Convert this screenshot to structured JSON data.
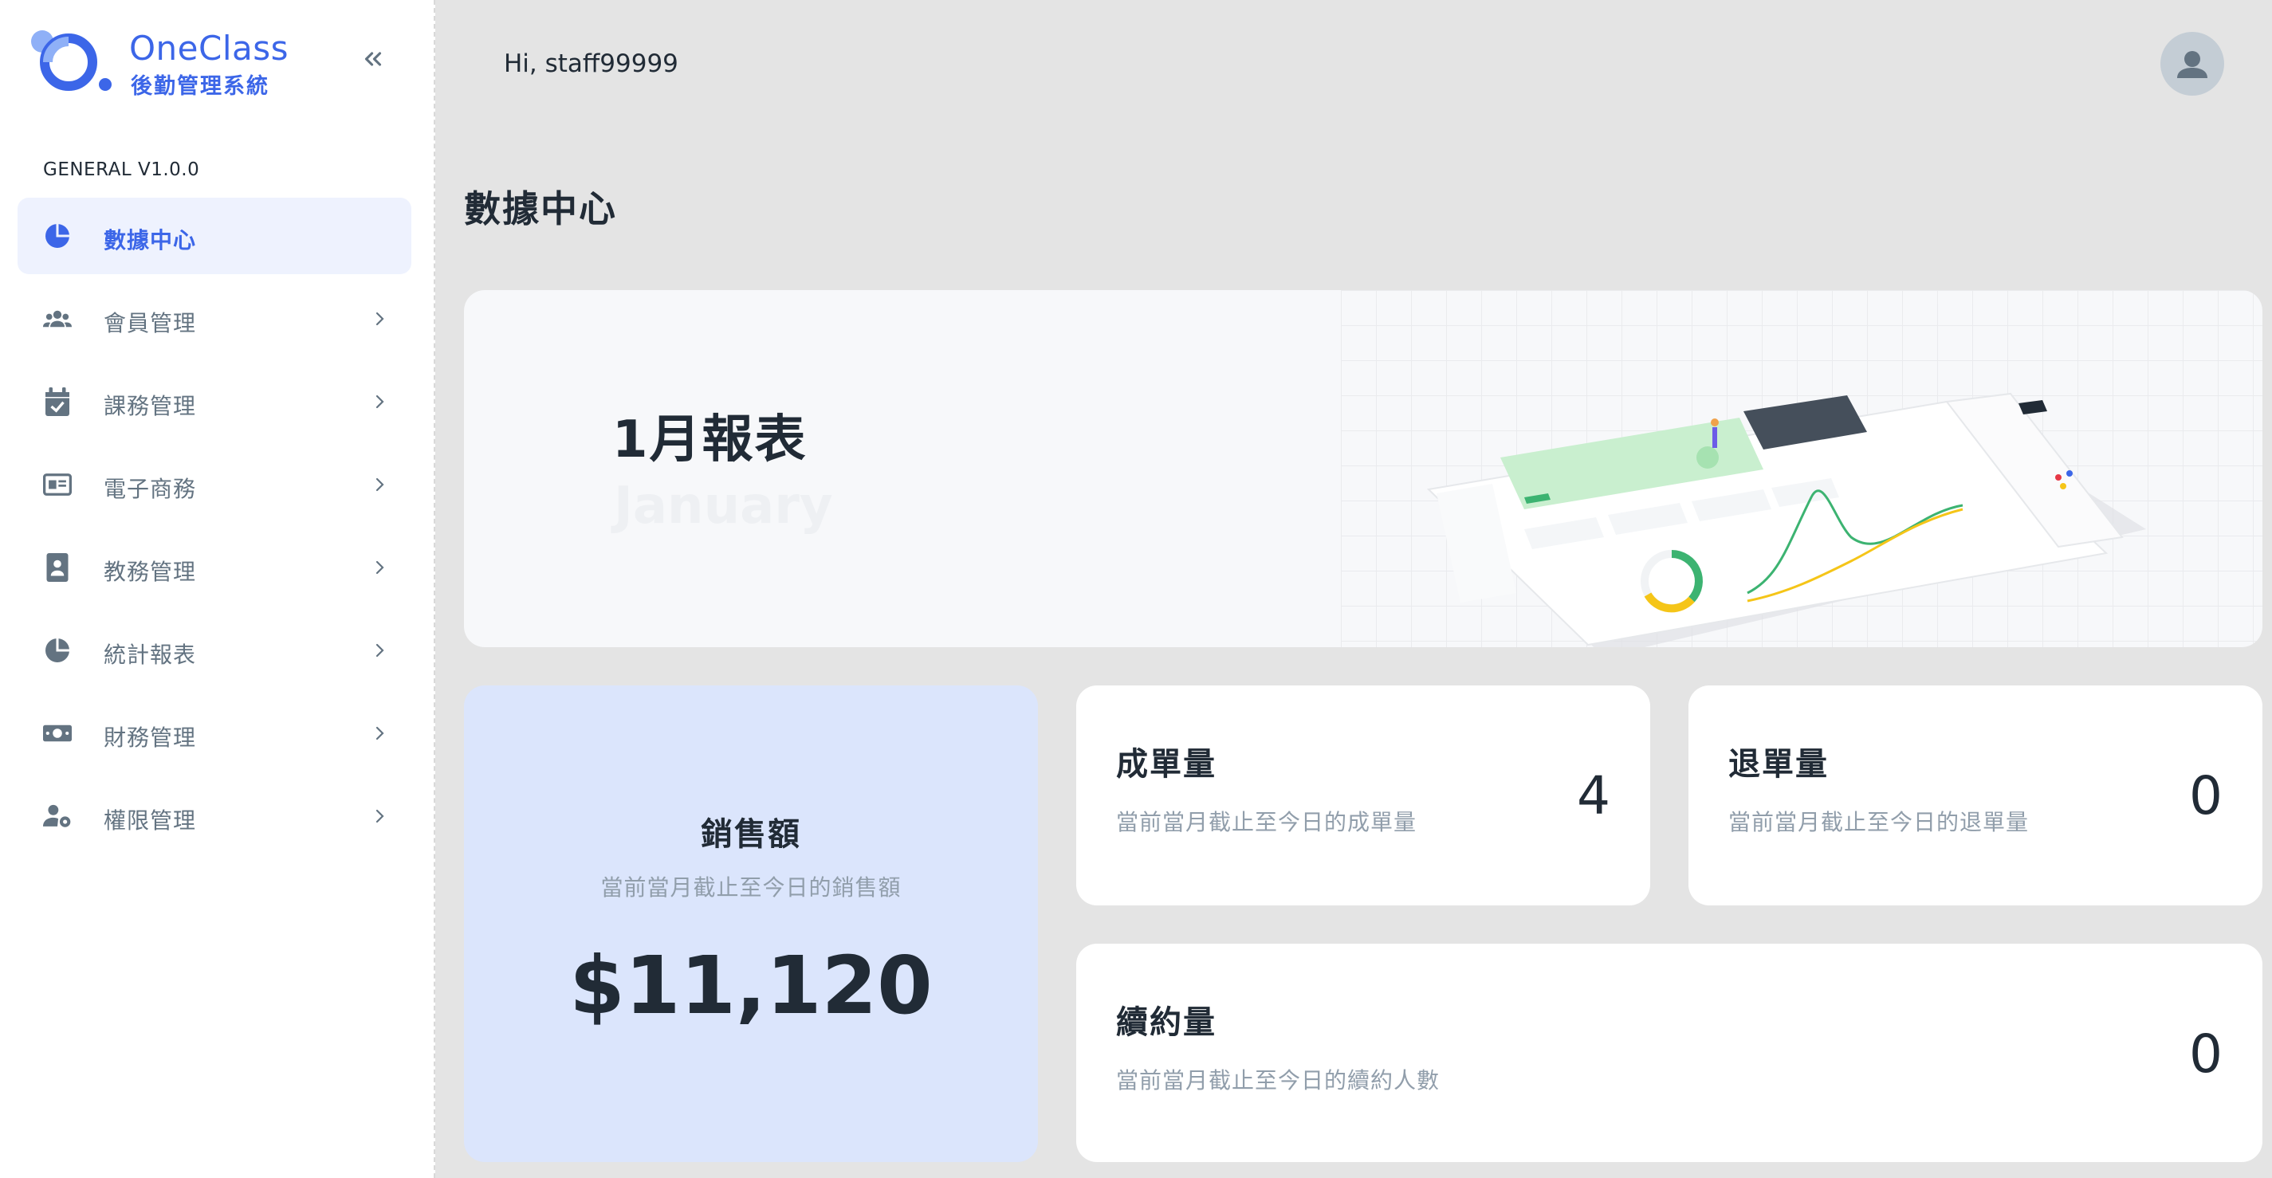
{
  "brand": {
    "name": "OneClass",
    "subtitle": "後勤管理系統",
    "color": "#3c66e8"
  },
  "sidebar": {
    "section_label": "GENERAL V1.0.0",
    "items": [
      {
        "label": "數據中心",
        "icon": "pie-chart-icon",
        "active": true
      },
      {
        "label": "會員管理",
        "icon": "users-icon",
        "active": false
      },
      {
        "label": "課務管理",
        "icon": "calendar-check-icon",
        "active": false
      },
      {
        "label": "電子商務",
        "icon": "id-card-icon",
        "active": false
      },
      {
        "label": "教務管理",
        "icon": "badge-icon",
        "active": false
      },
      {
        "label": "統計報表",
        "icon": "pie-chart-icon",
        "active": false
      },
      {
        "label": "財務管理",
        "icon": "money-icon",
        "active": false
      },
      {
        "label": "權限管理",
        "icon": "user-gear-icon",
        "active": false
      }
    ]
  },
  "header": {
    "greeting": "Hi, staff99999"
  },
  "page": {
    "title": "數據中心"
  },
  "banner": {
    "title": "1月報表",
    "subtitle": "January"
  },
  "stats": {
    "sales": {
      "title": "銷售額",
      "desc": "當前當月截止至今日的銷售額",
      "value": "$11,120"
    },
    "orders": {
      "title": "成單量",
      "desc": "當前當月截止至今日的成單量",
      "value": "4"
    },
    "refunds": {
      "title": "退單量",
      "desc": "當前當月截止至今日的退單量",
      "value": "0"
    },
    "renewals": {
      "title": "續約量",
      "desc": "當前當月截止至今日的續約人數",
      "value": "0"
    }
  }
}
